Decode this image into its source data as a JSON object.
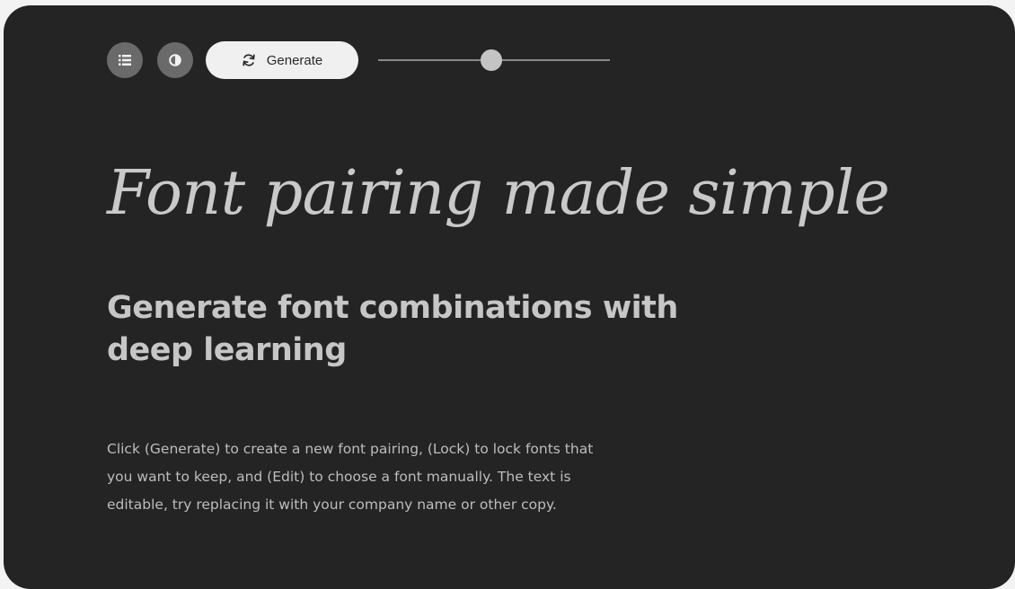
{
  "toolbar": {
    "list_button_icon": "list-icon",
    "theme_button_icon": "contrast-icon",
    "generate_button": {
      "icon": "refresh-icon",
      "label": "Generate"
    },
    "size_slider": {
      "value_fraction": 0.49
    }
  },
  "content": {
    "headline": "Font pairing made simple",
    "subheading": "Generate font combinations with deep learning",
    "body": "Click (Generate) to create a new font pairing, (Lock) to lock fonts that you want to keep, and (Edit) to choose a font manually. The text is editable, try replacing it with your company name or other copy."
  },
  "colors": {
    "background": "#242424",
    "outer_background": "#f3f3f4",
    "headline": "#c9c9c9",
    "button_dark": "#6a6a6a",
    "button_light": "#f0f0f0",
    "slider_thumb": "#c4c4c4"
  }
}
